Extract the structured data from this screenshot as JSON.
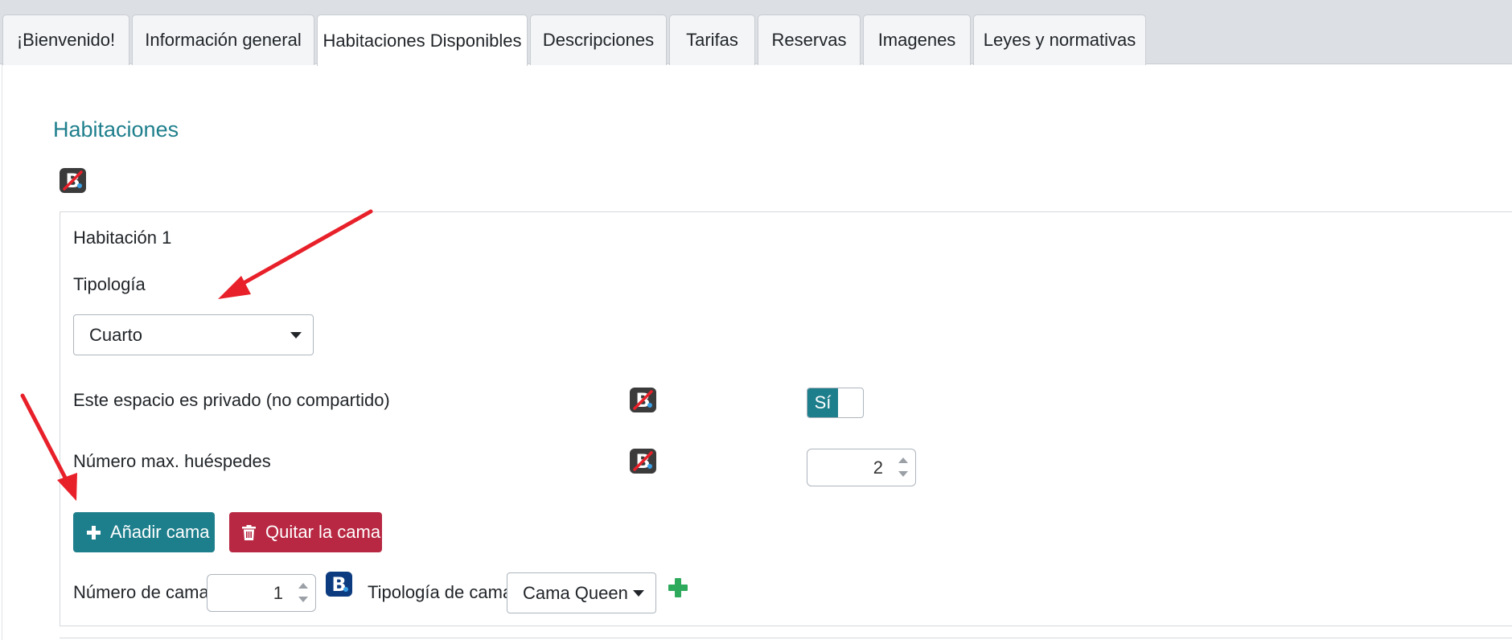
{
  "tabs": [
    {
      "label": "¡Bienvenido!"
    },
    {
      "label": "Información general"
    },
    {
      "label": "Habitaciones Disponibles"
    },
    {
      "label": "Descripciones"
    },
    {
      "label": "Tarifas"
    },
    {
      "label": "Reservas"
    },
    {
      "label": "Imagenes"
    },
    {
      "label": "Leyes y normativas"
    }
  ],
  "active_tab": "Habitaciones Disponibles",
  "section": {
    "title": "Habitaciones"
  },
  "room": {
    "title": "Habitación 1",
    "typology_label": "Tipología",
    "typology_value": "Cuarto",
    "private_label": "Este espacio es privado (no compartido)",
    "private_toggle_on_label": "Sí",
    "max_guests_label": "Número max. huéspedes",
    "max_guests_value": "2",
    "add_bed_label": "Añadir cama",
    "remove_bed_label": "Quitar la cama",
    "beds_count_label": "Número de camas",
    "beds_count_value": "1",
    "bed_type_label": "Tipología de cama",
    "bed_type_value": "Cama Queen"
  },
  "icons": {
    "booking_disabled": "booking-disabled-icon",
    "booking": "booking-icon",
    "plus": "plus-icon",
    "trash": "trash-icon",
    "add_bed_type": "green-plus-icon"
  },
  "colors": {
    "accent": "#1e7f8c",
    "danger": "#b82843",
    "success": "#2eaa5d",
    "annotation_arrow": "#e8202a",
    "booking_blue": "#0c3b80"
  }
}
